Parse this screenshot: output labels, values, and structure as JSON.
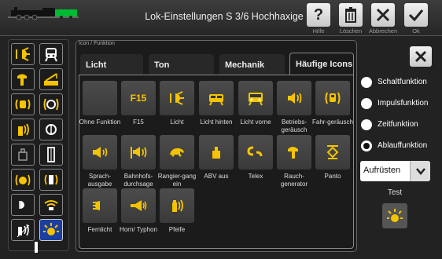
{
  "header": {
    "title": "Lok-Einstellungen S 3/6 Hochhaxige",
    "buttons": [
      {
        "label": "Hilfe",
        "icon": "question-icon"
      },
      {
        "label": "Löschen",
        "icon": "trash-icon"
      },
      {
        "label": "Abbrechen",
        "icon": "close-icon"
      },
      {
        "label": "Ok",
        "icon": "check-icon"
      }
    ]
  },
  "category_label": "Icon / Funktion",
  "tabs": [
    {
      "label": "Licht",
      "active": false
    },
    {
      "label": "Ton",
      "active": false
    },
    {
      "label": "Mechanik",
      "active": false
    },
    {
      "label": "Häufige Icons",
      "active": true
    }
  ],
  "icons": [
    {
      "label": "Ohne Funktion",
      "icon": "empty-icon",
      "text": ""
    },
    {
      "label": "F15",
      "icon": "f15-icon",
      "text": "F15"
    },
    {
      "label": "Licht",
      "icon": "light-icon",
      "text": ""
    },
    {
      "label": "Licht hinten",
      "icon": "light-rear-icon",
      "text": ""
    },
    {
      "label": "Licht vorne",
      "icon": "light-front-icon",
      "text": ""
    },
    {
      "label": "Betriebs-geräusch",
      "icon": "operating-sound-icon",
      "text": ""
    },
    {
      "label": "Fahr-geräusch",
      "icon": "driving-sound-icon",
      "text": ""
    },
    {
      "label": "Sprach-ausgabe",
      "icon": "speech-icon",
      "text": ""
    },
    {
      "label": "Bahnhofs-durchsage",
      "icon": "station-announcement-icon",
      "text": ""
    },
    {
      "label": "Rangier-gang ein",
      "icon": "shunting-icon",
      "text": ""
    },
    {
      "label": "ABV aus",
      "icon": "abv-icon",
      "text": ""
    },
    {
      "label": "Telex",
      "icon": "telex-icon",
      "text": ""
    },
    {
      "label": "Rauch-generator",
      "icon": "smoke-icon",
      "text": ""
    },
    {
      "label": "Panto",
      "icon": "panto-icon",
      "text": ""
    },
    {
      "label": "Fernlicht",
      "icon": "high-beam-icon",
      "text": ""
    },
    {
      "label": "Horn/ Typhon",
      "icon": "horn-icon",
      "text": ""
    },
    {
      "label": "Pfeife",
      "icon": "whistle-icon",
      "text": ""
    }
  ],
  "right_panel": {
    "options": [
      {
        "label": "Schaltfunktion",
        "selected": false
      },
      {
        "label": "Impulsfunktion",
        "selected": false
      },
      {
        "label": "Zeitfunktion",
        "selected": false
      },
      {
        "label": "Ablauffunktion",
        "selected": true
      }
    ],
    "select_value": "Aufrüsten",
    "test_label": "Test"
  },
  "colors": {
    "icon_yellow": "#f5c400",
    "accent_blue": "#1b3fa0"
  }
}
